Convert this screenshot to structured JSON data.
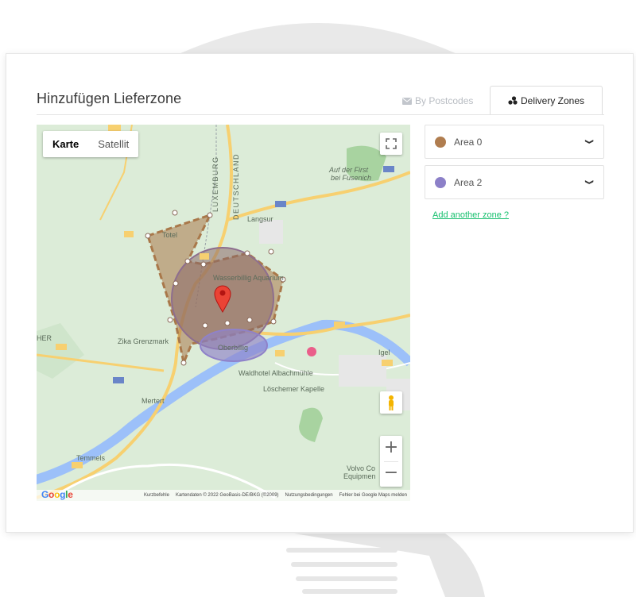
{
  "page": {
    "title": "Hinzufügen Lieferzone",
    "tabs": [
      {
        "label": "By Postcodes",
        "icon": "envelope-icon",
        "active": false
      },
      {
        "label": "Delivery Zones",
        "icon": "zones-icon",
        "active": true
      }
    ]
  },
  "map": {
    "map_type": {
      "karte": "Karte",
      "satellit": "Satellit",
      "selected": "Karte"
    },
    "labels": {
      "luxemburg": "LUXEMBURG",
      "deutschland": "DEUTSCHLAND",
      "langsur": "Langsur",
      "first": "Auf der First",
      "fusenich": "bei Fusenich",
      "totel": "Totel",
      "wasserbillig": "Wasserbillig Aquarium",
      "oberbillig": "Oberbillig",
      "zika": "Zika Grenzmark",
      "waldhotel": "Waldhotel Albachmühle",
      "kapelle": "Löschemer Kapelle",
      "mertert": "Mertert",
      "temmels": "Temmels",
      "igel": "Igel",
      "volvo": "Volvo Co",
      "equipment": "Equipmen",
      "her": "HER"
    },
    "zoom": {
      "in": "+",
      "out": "−"
    },
    "attribution": {
      "logo": "Google",
      "shortcuts": "Kurzbefehle",
      "data": "Kartendaten © 2022 GeoBasis-DE/BKG (©2009)",
      "terms": "Nutzungsbedingungen",
      "report": "Fehler bei Google Maps melden"
    },
    "colors": {
      "area0": "#a9784a",
      "area2": "#8f82c9",
      "water": "#9cc0f9",
      "road": "#f7d070"
    }
  },
  "zones": {
    "items": [
      {
        "label": "Area 0",
        "color": "#b07d4f"
      },
      {
        "label": "Area 2",
        "color": "#8c80c8"
      }
    ],
    "add_link": "Add another zone ?"
  }
}
